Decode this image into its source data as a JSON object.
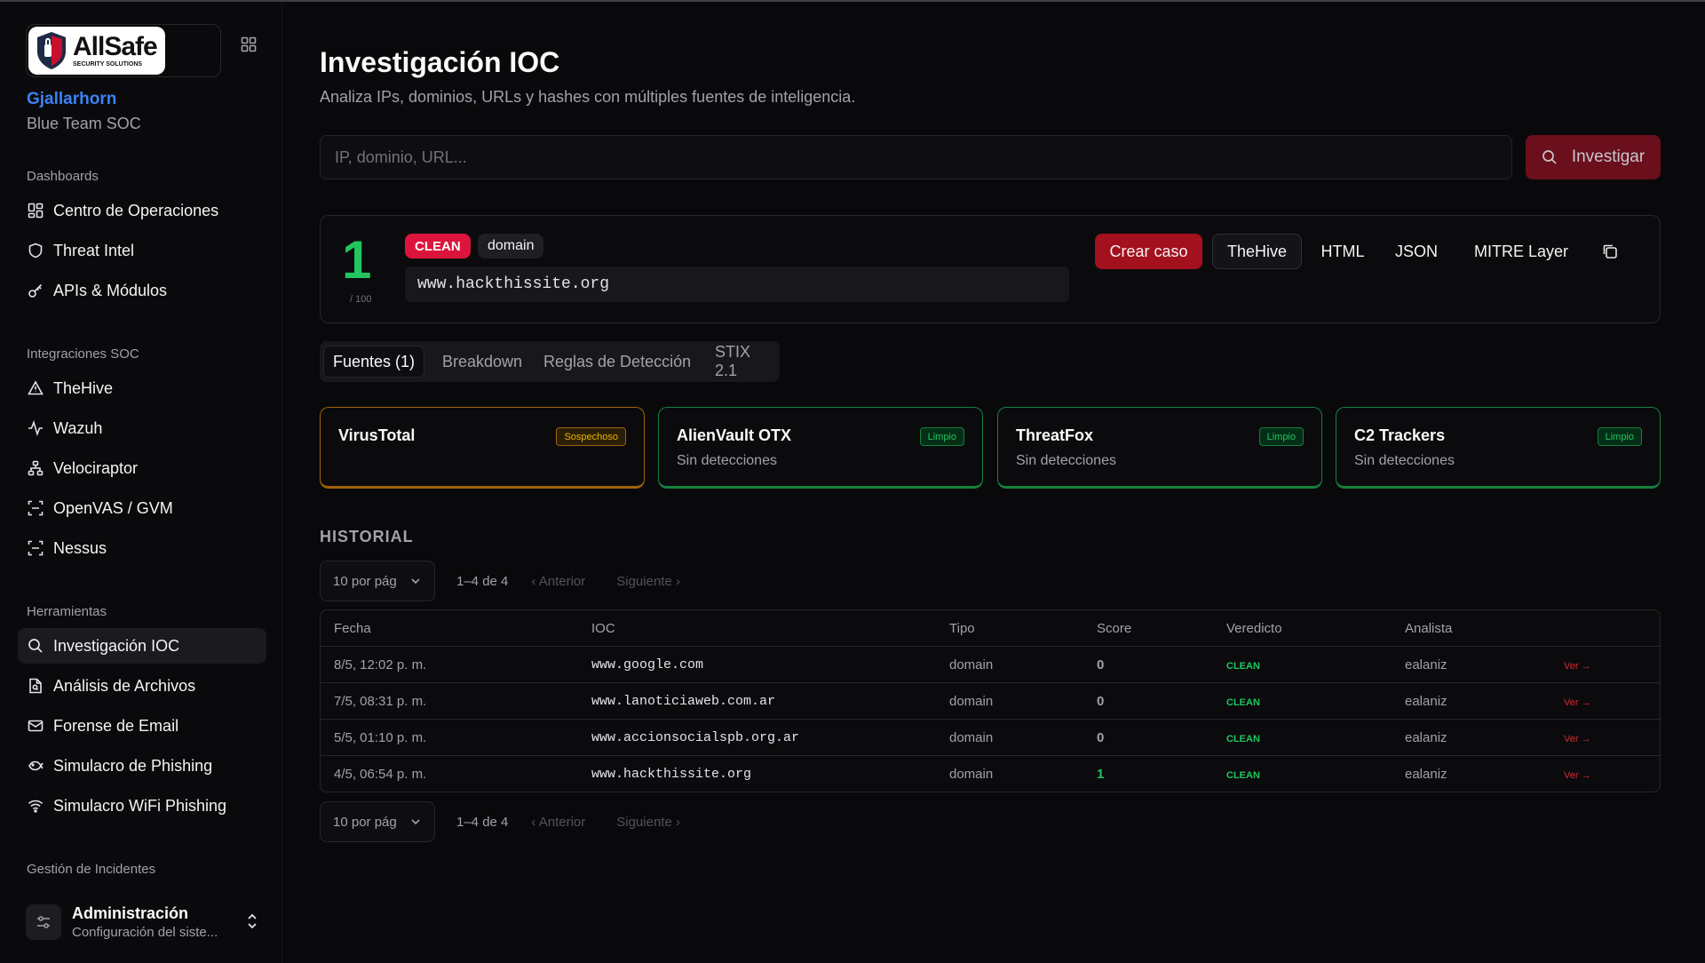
{
  "sidebar": {
    "logo_text": "AllSafe",
    "logo_sub": "SECURITY SOLUTIONS",
    "org_name": "Gjallarhorn",
    "org_team": "Blue Team SOC",
    "sections": [
      {
        "title": "Dashboards",
        "items": [
          {
            "label": "Centro de Operaciones",
            "icon": "dashboard-icon"
          },
          {
            "label": "Threat Intel",
            "icon": "shield-icon"
          },
          {
            "label": "APIs & Módulos",
            "icon": "key-icon"
          }
        ]
      },
      {
        "title": "Integraciones SOC",
        "items": [
          {
            "label": "TheHive",
            "icon": "warning-triangle-icon"
          },
          {
            "label": "Wazuh",
            "icon": "activity-icon"
          },
          {
            "label": "Velociraptor",
            "icon": "network-icon"
          },
          {
            "label": "OpenVAS / GVM",
            "icon": "scan-icon"
          },
          {
            "label": "Nessus",
            "icon": "scan-icon"
          }
        ]
      },
      {
        "title": "Herramientas",
        "items": [
          {
            "label": "Investigación IOC",
            "icon": "search-icon"
          },
          {
            "label": "Análisis de Archivos",
            "icon": "file-search-icon"
          },
          {
            "label": "Forense de Email",
            "icon": "mail-icon"
          },
          {
            "label": "Simulacro de Phishing",
            "icon": "fish-icon"
          },
          {
            "label": "Simulacro WiFi Phishing",
            "icon": "wifi-icon"
          }
        ]
      },
      {
        "title": "Gestión de Incidentes",
        "items": []
      }
    ],
    "admin": {
      "title": "Administración",
      "subtitle": "Configuración del siste..."
    }
  },
  "header": {
    "title": "Investigación IOC",
    "subtitle": "Analiza IPs, dominios, URLs y hashes con múltiples fuentes de inteligencia."
  },
  "search": {
    "placeholder": "IP, dominio, URL...",
    "button": "Investigar"
  },
  "result": {
    "score": "1",
    "score_max": "/ 100",
    "verdict": "CLEAN",
    "type": "domain",
    "ioc": "www.hackthissite.org",
    "actions": [
      "Crear caso",
      "TheHive",
      "HTML",
      "JSON",
      "MITRE Layer"
    ]
  },
  "tabs": [
    "Fuentes (1)",
    "Breakdown",
    "Reglas de Detección",
    "STIX 2.1"
  ],
  "sources": [
    {
      "name": "VirusTotal",
      "badge": "Sospechoso",
      "desc": "",
      "color": "#eab308"
    },
    {
      "name": "AlienVault OTX",
      "badge": "Limpio",
      "desc": "Sin detecciones",
      "color": "#22c55e"
    },
    {
      "name": "ThreatFox",
      "badge": "Limpio",
      "desc": "Sin detecciones",
      "color": "#22c55e"
    },
    {
      "name": "C2 Trackers",
      "badge": "Limpio",
      "desc": "Sin detecciones",
      "color": "#22c55e"
    }
  ],
  "history": {
    "title": "HISTORIAL",
    "per_page": "10 por pág",
    "range": "1–4 de 4",
    "prev": "‹ Anterior",
    "next": "Siguiente ›",
    "columns": [
      "Fecha",
      "IOC",
      "Tipo",
      "Score",
      "Veredicto",
      "Analista"
    ],
    "rows": [
      {
        "fecha": "8/5, 12:02 p. m.",
        "ioc": "www.google.com",
        "tipo": "domain",
        "score": "0",
        "veredicto": "CLEAN",
        "analista": "ealaniz",
        "link": "Ver →"
      },
      {
        "fecha": "7/5, 08:31 p. m.",
        "ioc": "www.lanoticiaweb.com.ar",
        "tipo": "domain",
        "score": "0",
        "veredicto": "CLEAN",
        "analista": "ealaniz",
        "link": "Ver →"
      },
      {
        "fecha": "5/5, 01:10 p. m.",
        "ioc": "www.accionsocialspb.org.ar",
        "tipo": "domain",
        "score": "0",
        "veredicto": "CLEAN",
        "analista": "ealaniz",
        "link": "Ver →"
      },
      {
        "fecha": "4/5, 06:54 p. m.",
        "ioc": "www.hackthissite.org",
        "tipo": "domain",
        "score": "1",
        "veredicto": "CLEAN",
        "analista": "ealaniz",
        "link": "Ver →"
      }
    ]
  }
}
